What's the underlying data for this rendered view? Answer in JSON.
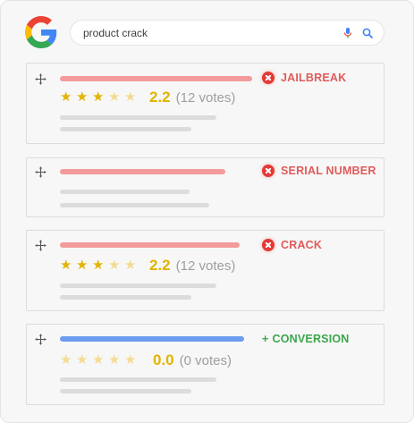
{
  "search": {
    "query": "product crack"
  },
  "cards": [
    {
      "label": "JAILBREAK",
      "kind": "negative",
      "rating": 2.2,
      "score_text": "2.2",
      "votes_text": "(12 votes)",
      "stars_filled": 3
    },
    {
      "label": "SERIAL NUMBER",
      "kind": "negative"
    },
    {
      "label": "CRACK",
      "kind": "negative",
      "rating": 2.2,
      "score_text": "2.2",
      "votes_text": "(12 votes)",
      "stars_filled": 3
    },
    {
      "label": "CONVERSION",
      "kind": "positive",
      "tag_prefix": "+",
      "rating": 0.0,
      "score_text": "0.0",
      "votes_text": "(0 votes)",
      "stars_filled": 0
    }
  ],
  "colors": {
    "negative_bar": "#f39b9b",
    "positive_bar": "#6b9cf0",
    "negative_text": "#e05a5a",
    "positive_text": "#3aa64a",
    "star": "#e2b400"
  },
  "icons": [
    "google-logo",
    "mic-icon",
    "search-icon",
    "drag-handle-icon",
    "remove-icon"
  ]
}
